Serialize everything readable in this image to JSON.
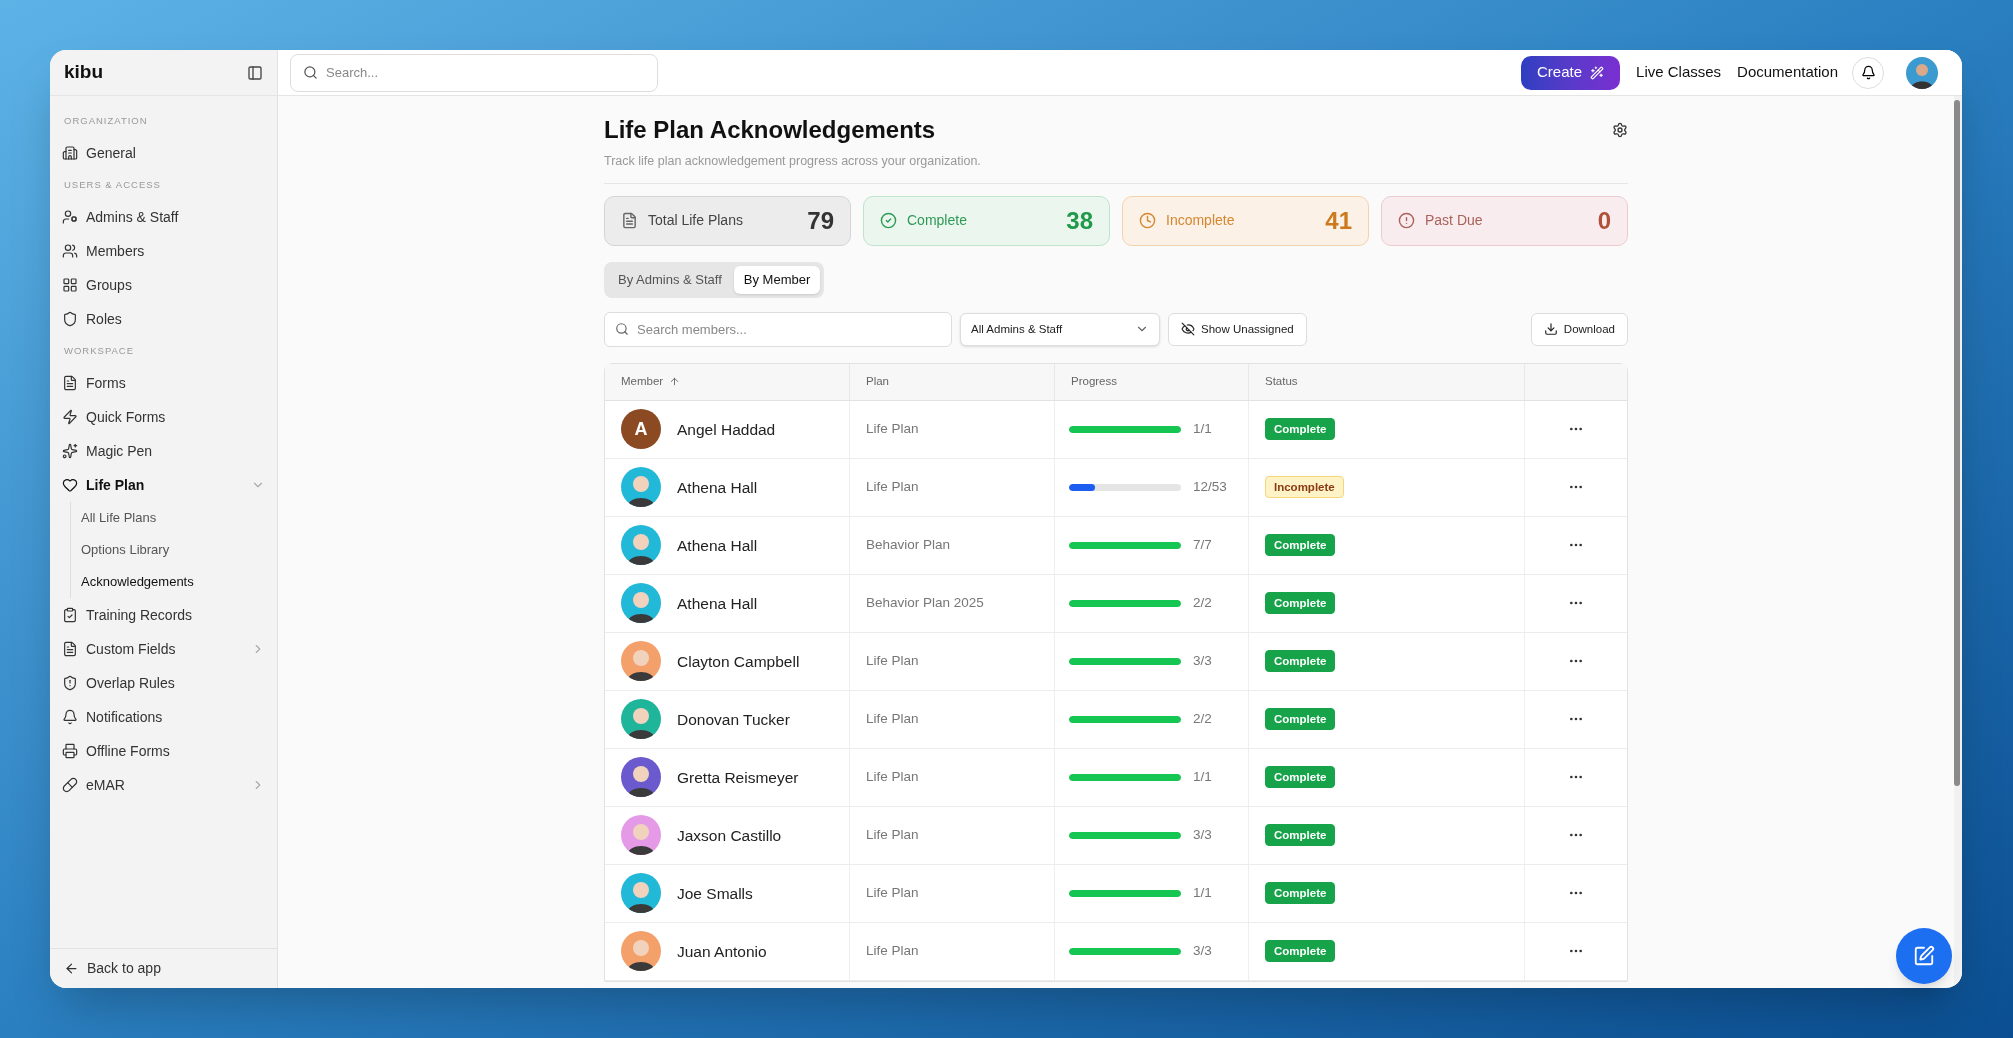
{
  "sidebar": {
    "logo": "kibu",
    "sections": [
      {
        "label": "ORGANIZATION",
        "items": [
          {
            "label": "General"
          }
        ]
      },
      {
        "label": "USERS & ACCESS",
        "items": [
          {
            "label": "Admins & Staff"
          },
          {
            "label": "Members"
          },
          {
            "label": "Groups"
          },
          {
            "label": "Roles"
          }
        ]
      },
      {
        "label": "WORKSPACE",
        "items": [
          {
            "label": "Forms"
          },
          {
            "label": "Quick Forms"
          },
          {
            "label": "Magic Pen"
          },
          {
            "label": "Life Plan",
            "expanded": true,
            "children": [
              {
                "label": "All Life Plans",
                "selected": false
              },
              {
                "label": "Options Library",
                "selected": false
              },
              {
                "label": "Acknowledgements",
                "selected": true
              }
            ]
          },
          {
            "label": "Training Records"
          },
          {
            "label": "Custom Fields",
            "expanded": false
          },
          {
            "label": "Overlap Rules"
          },
          {
            "label": "Notifications"
          },
          {
            "label": "Offline Forms"
          },
          {
            "label": "eMAR",
            "expanded": false
          }
        ]
      }
    ],
    "back_link": "Back to app"
  },
  "topbar": {
    "search": {
      "placeholder": "Search..."
    },
    "create_button": "Create",
    "links": [
      "Live Classes",
      "Documentation"
    ]
  },
  "page": {
    "title": "Life Plan Acknowledgements",
    "subtitle": "Track life plan acknowledgement progress across your organization.",
    "stats": [
      {
        "kind": "total",
        "label": "Total Life Plans",
        "value": "79"
      },
      {
        "kind": "complete",
        "label": "Complete",
        "value": "38"
      },
      {
        "kind": "incomplete",
        "label": "Incomplete",
        "value": "41"
      },
      {
        "kind": "past_due",
        "label": "Past Due",
        "value": "0"
      }
    ],
    "view_tabs": [
      {
        "label": "By Admins & Staff",
        "selected": false
      },
      {
        "label": "By Member",
        "selected": true
      }
    ],
    "member_search": {
      "placeholder": "Search members..."
    },
    "staff_filter": "All Admins & Staff",
    "show_unassigned": "Show Unassigned",
    "download": "Download"
  },
  "table": {
    "columns": [
      "Member",
      "Plan",
      "Progress",
      "Status"
    ],
    "rows": [
      {
        "member": "Angel Haddad",
        "avatar": {
          "kind": "initial",
          "initial": "A",
          "color": "#8b4a22"
        },
        "plan": "Life Plan",
        "level": 1,
        "progress": "1/1",
        "status": {
          "kind": "complete",
          "label": "Complete"
        }
      },
      {
        "member": "Athena Hall",
        "avatar": {
          "kind": "photo",
          "color": "#22b8d8"
        },
        "plan": "Life Plan",
        "level": 0.23,
        "progress": "12/53",
        "status": {
          "kind": "incomplete",
          "label": "Incomplete"
        }
      },
      {
        "member": "Athena Hall",
        "avatar": {
          "kind": "photo",
          "color": "#22b8d8"
        },
        "plan": "Behavior Plan",
        "level": 1,
        "progress": "7/7",
        "status": {
          "kind": "complete",
          "label": "Complete"
        }
      },
      {
        "member": "Athena Hall",
        "avatar": {
          "kind": "photo",
          "color": "#22b8d8"
        },
        "plan": "Behavior Plan 2025",
        "level": 1,
        "progress": "2/2",
        "status": {
          "kind": "complete",
          "label": "Complete"
        }
      },
      {
        "member": "Clayton Campbell",
        "avatar": {
          "kind": "photo",
          "color": "#f4a06a"
        },
        "plan": "Life Plan",
        "level": 1,
        "progress": "3/3",
        "status": {
          "kind": "complete",
          "label": "Complete"
        }
      },
      {
        "member": "Donovan Tucker",
        "avatar": {
          "kind": "photo",
          "color": "#1fb59a"
        },
        "plan": "Life Plan",
        "level": 1,
        "progress": "2/2",
        "status": {
          "kind": "complete",
          "label": "Complete"
        }
      },
      {
        "member": "Gretta Reismeyer",
        "avatar": {
          "kind": "photo",
          "color": "#6a5acd"
        },
        "plan": "Life Plan",
        "level": 1,
        "progress": "1/1",
        "status": {
          "kind": "complete",
          "label": "Complete"
        }
      },
      {
        "member": "Jaxson Castillo",
        "avatar": {
          "kind": "photo",
          "color": "#e59ae8"
        },
        "plan": "Life Plan",
        "level": 1,
        "progress": "3/3",
        "status": {
          "kind": "complete",
          "label": "Complete"
        }
      },
      {
        "member": "Joe Smalls",
        "avatar": {
          "kind": "photo",
          "color": "#22b8d8"
        },
        "plan": "Life Plan",
        "level": 1,
        "progress": "1/1",
        "status": {
          "kind": "complete",
          "label": "Complete"
        }
      },
      {
        "member": "Juan Antonio",
        "avatar": {
          "kind": "photo",
          "color": "#f4a06a"
        },
        "plan": "Life Plan",
        "level": 1,
        "progress": "3/3",
        "status": {
          "kind": "complete",
          "label": "Complete"
        }
      }
    ]
  }
}
